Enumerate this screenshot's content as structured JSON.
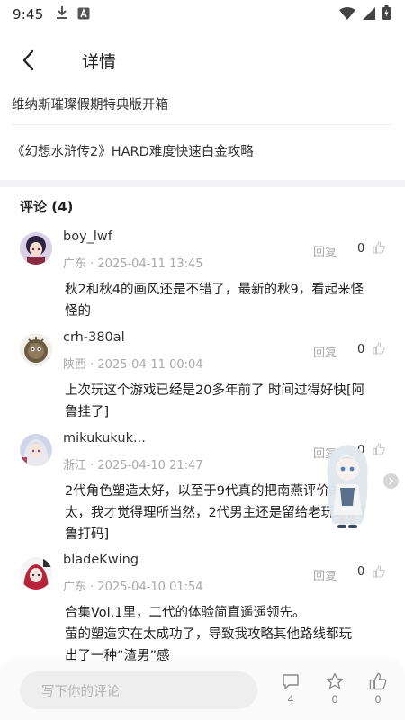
{
  "status_bar": {
    "time": "9:45"
  },
  "header": {
    "title": "详情"
  },
  "related": [
    {
      "title": "维纳斯璀璨假期特典版开箱"
    },
    {
      "title": "《幻想水浒传2》HARD难度快速白金攻略"
    }
  ],
  "comments_section": {
    "title": "评论 (4)"
  },
  "comments": [
    {
      "username": "boy_lwf",
      "meta": "广东 · 2025-04-11 13:45",
      "reply_label": "回复",
      "likes": "0",
      "lines": [
        "秋2和秋4的画风还是不错了，最新的秋9，看起来怪",
        "怪的"
      ]
    },
    {
      "username": "crh-380al",
      "meta": "陕西 · 2025-04-11 00:04",
      "reply_label": "回复",
      "likes": "0",
      "lines": [
        "上次玩这个游戏已经是20多年前了 时间过得好快[阿",
        "鲁挂了]"
      ]
    },
    {
      "username": "mikukukuk...",
      "meta": "浙江 · 2025-04-10 21:47",
      "reply_label": "回复",
      "likes": "0",
      "lines": [
        "2代角色塑造太好，以至于9代真的把南燕评价的很",
        "太，我才觉得理所当然，2代男主还是留给老玩家[阿",
        "鲁打码]"
      ]
    },
    {
      "username": "bladeKwing",
      "meta": "广东 · 2025-04-10 01:54",
      "reply_label": "回复",
      "likes": "0",
      "lines": [
        "合集Vol.1里，二代的体验简直遥遥领先。",
        "萤的塑造实在太成功了，导致我攻略其他路线都玩",
        "出了一种“渣男”感"
      ]
    }
  ],
  "bottom_bar": {
    "input_placeholder": "写下你的评论",
    "comment_count": "4",
    "favorite_count": "0",
    "like_count": "0"
  }
}
